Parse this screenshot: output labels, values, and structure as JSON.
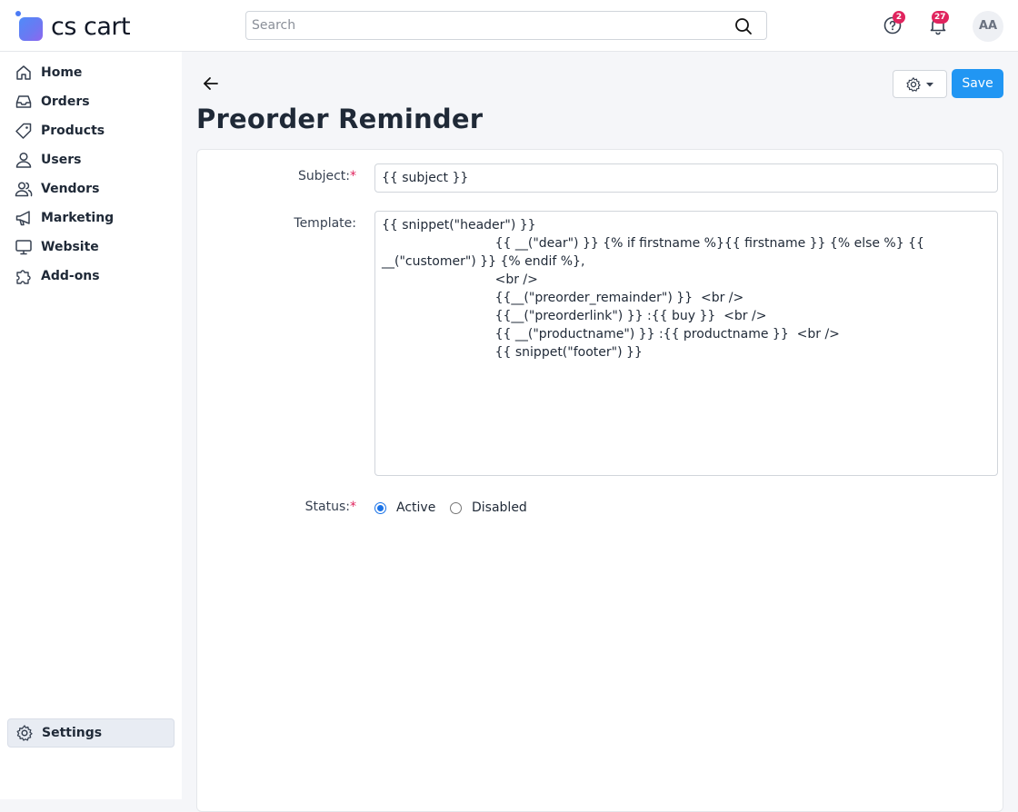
{
  "header": {
    "logo_text": "cs cart",
    "search_placeholder": "Search",
    "help_badge": "2",
    "notifications_badge": "27",
    "avatar_initials": "AA"
  },
  "sidebar": {
    "items": [
      {
        "label": "Home",
        "icon": "home-icon"
      },
      {
        "label": "Orders",
        "icon": "inbox-icon"
      },
      {
        "label": "Products",
        "icon": "tag-icon"
      },
      {
        "label": "Users",
        "icon": "user-icon"
      },
      {
        "label": "Vendors",
        "icon": "users-icon"
      },
      {
        "label": "Marketing",
        "icon": "megaphone-icon"
      },
      {
        "label": "Website",
        "icon": "monitor-icon"
      },
      {
        "label": "Add-ons",
        "icon": "puzzle-icon"
      }
    ],
    "settings_label": "Settings"
  },
  "toolbar": {
    "save_label": "Save",
    "save_color": "#2196f3"
  },
  "page": {
    "title": "Preorder Reminder"
  },
  "form": {
    "subject_label": "Subject:",
    "subject_value": "{{ subject }}",
    "template_label": "Template:",
    "template_value": "{{ snippet(\"header\") }}\n                            {{ __(\"dear\") }} {% if firstname %}{{ firstname }} {% else %} {{ __(\"customer\") }} {% endif %},\n                            <br />\n                            {{__(\"preorder_remainder\") }}  <br />\n                            {{__(\"preorderlink\") }} :{{ buy }}  <br />\n                            {{ __(\"productname\") }} :{{ productname }}  <br />\n                            {{ snippet(\"footer\") }}",
    "status_label": "Status:",
    "status_options": [
      "Active",
      "Disabled"
    ],
    "status_selected": "Active",
    "required_mark": "*"
  }
}
